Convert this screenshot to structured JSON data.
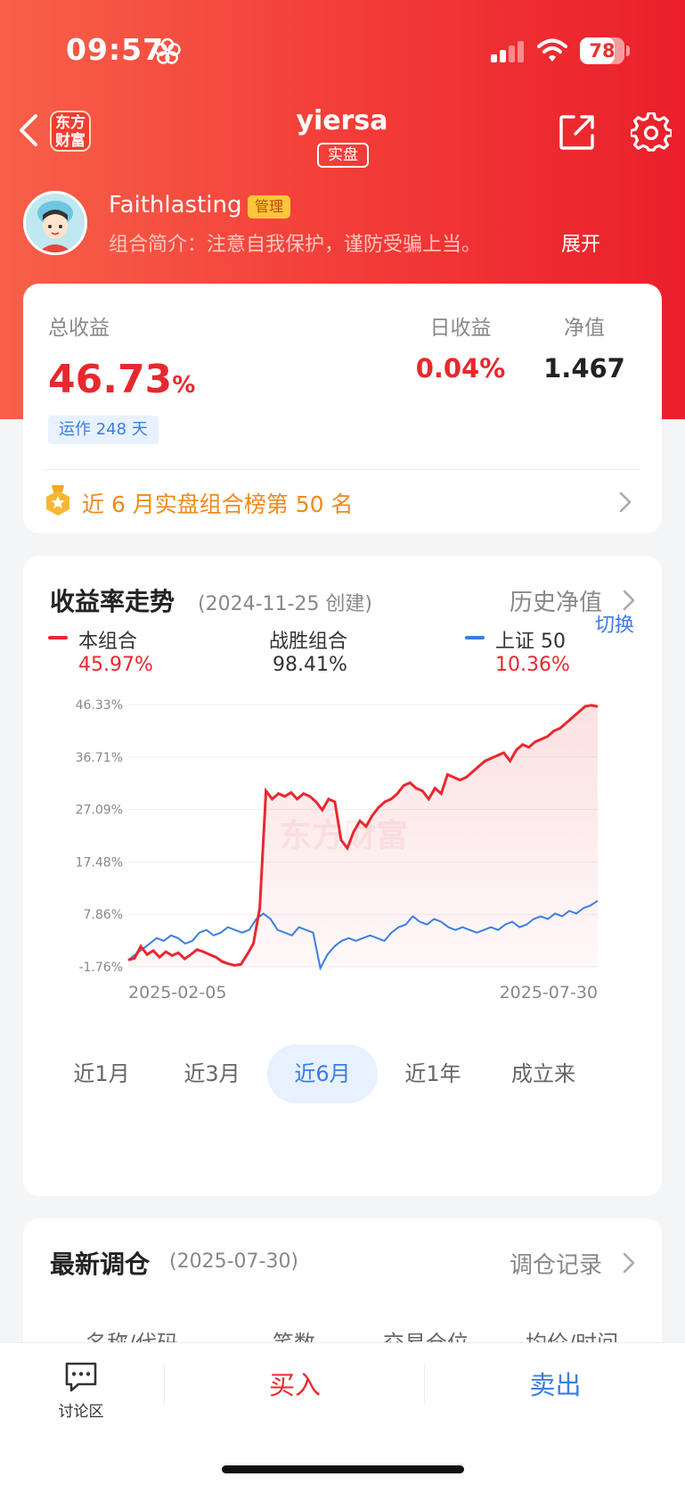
{
  "status_bar": {
    "time": "09:57",
    "battery": "78",
    "battery_level": 0.78
  },
  "nav": {
    "logo_line1": "东方",
    "logo_line2": "财富",
    "title": "yiersa",
    "badge": "实盘"
  },
  "owner": {
    "name": "Faithlasting",
    "tag": "管理",
    "desc": "组合简介：注意自我保护，谨防受骗上当。",
    "expand": "展开"
  },
  "summary": {
    "total_label": "总收益",
    "total_value": "46.73",
    "total_unit": "%",
    "day_label": "日收益",
    "day_value": "0.04%",
    "nav_label": "净值",
    "nav_value": "1.467",
    "run_days": "运作 248 天",
    "rank_text": "近 6 月实盘组合榜第 50 名"
  },
  "trend": {
    "title": "收益率走势",
    "created": "(2024-11-25 创建)",
    "history_link": "历史净值",
    "switch_label": "切换",
    "legend": [
      {
        "name": "本组合",
        "value": "45.97%",
        "color": "#e8282e"
      },
      {
        "name": "战胜组合",
        "value": "98.41%",
        "color": "#333333"
      },
      {
        "name": "上证 50",
        "value": "10.36%",
        "color": "#3a7ee6"
      }
    ],
    "periods": [
      "近1月",
      "近3月",
      "近6月",
      "近1年",
      "成立来"
    ],
    "active_period": "近6月"
  },
  "chart_data": {
    "type": "line",
    "x_start": "2025-02-05",
    "x_end": "2025-07-30",
    "y_ticks": [
      "46.33%",
      "36.71%",
      "27.09%",
      "17.48%",
      "7.86%",
      "-1.76%"
    ],
    "ylim": [
      -1.76,
      46.33
    ],
    "watermark": "东方财富",
    "series": [
      {
        "name": "本组合",
        "color": "#e8282e",
        "values": [
          -0.5,
          -0.2,
          2.0,
          0.5,
          1.2,
          0.0,
          1.0,
          0.3,
          0.8,
          -0.3,
          0.5,
          1.4,
          1.0,
          0.5,
          0.0,
          -0.8,
          -1.2,
          -1.5,
          -1.3,
          0.5,
          2.5,
          9.0,
          30.5,
          29.0,
          30.0,
          29.5,
          30.2,
          29.0,
          30.0,
          29.5,
          28.5,
          27.0,
          29.0,
          28.5,
          21.5,
          20.0,
          23.0,
          25.0,
          24.0,
          26.0,
          27.5,
          28.5,
          29.0,
          30.0,
          31.5,
          32.0,
          31.0,
          30.5,
          29.0,
          31.0,
          30.0,
          33.5,
          33.0,
          32.5,
          33.0,
          34.0,
          35.0,
          36.0,
          36.5,
          37.0,
          37.5,
          36.0,
          38.0,
          39.0,
          38.5,
          39.5,
          40.0,
          40.5,
          41.5,
          42.0,
          43.0,
          44.0,
          45.0,
          46.0,
          46.2,
          45.97
        ]
      },
      {
        "name": "上证 50",
        "color": "#3a7ee6",
        "values": [
          -0.5,
          0.5,
          1.5,
          2.5,
          3.5,
          3.0,
          4.0,
          3.5,
          2.5,
          3.0,
          4.5,
          5.0,
          4.0,
          4.5,
          5.5,
          5.0,
          4.5,
          5.0,
          7.0,
          8.0,
          7.0,
          5.0,
          4.5,
          4.0,
          5.5,
          5.0,
          4.5,
          -2.0,
          0.5,
          2.0,
          3.0,
          3.5,
          3.0,
          3.5,
          4.0,
          3.5,
          3.0,
          4.5,
          5.5,
          6.0,
          7.5,
          6.5,
          6.0,
          7.0,
          6.5,
          5.5,
          5.0,
          5.5,
          5.0,
          4.5,
          5.0,
          5.5,
          5.0,
          6.0,
          6.5,
          5.5,
          6.0,
          7.0,
          7.5,
          7.0,
          8.0,
          7.5,
          8.5,
          8.0,
          9.0,
          9.5,
          10.36
        ]
      }
    ]
  },
  "trades": {
    "title": "最新调仓",
    "date": "(2025-07-30)",
    "record_link": "调仓记录",
    "columns": [
      "名称/代码",
      "笔数",
      "交易仓位",
      "均价/时间"
    ]
  },
  "bottom": {
    "discuss": "讨论区",
    "buy": "买入",
    "sell": "卖出"
  }
}
